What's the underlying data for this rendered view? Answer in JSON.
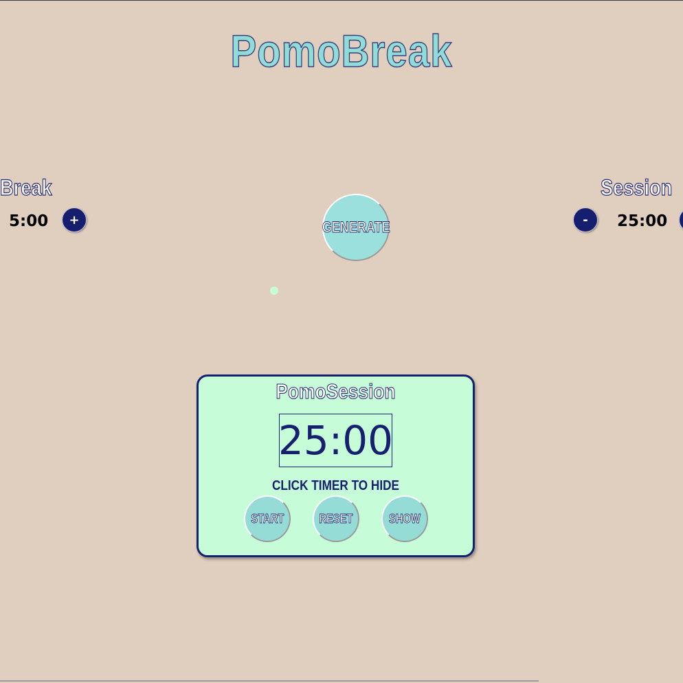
{
  "app": {
    "title": "PomoBreak"
  },
  "break_control": {
    "label": "Break",
    "value": "5:00",
    "increment_label": "+"
  },
  "session_control": {
    "label": "Session",
    "value": "25:00",
    "decrement_label": "-"
  },
  "generate_button": {
    "label": "GENERATE"
  },
  "session_card": {
    "title": "PomoSession",
    "timer": "25:00",
    "hint": "CLICK TIMER TO HIDE",
    "buttons": {
      "start": "START",
      "reset": "RESET",
      "show": "SHOW"
    }
  },
  "colors": {
    "background": "#e0cfbf",
    "navy": "#16206e",
    "teal": "#9be0dc",
    "mint": "#c6fcd8"
  }
}
